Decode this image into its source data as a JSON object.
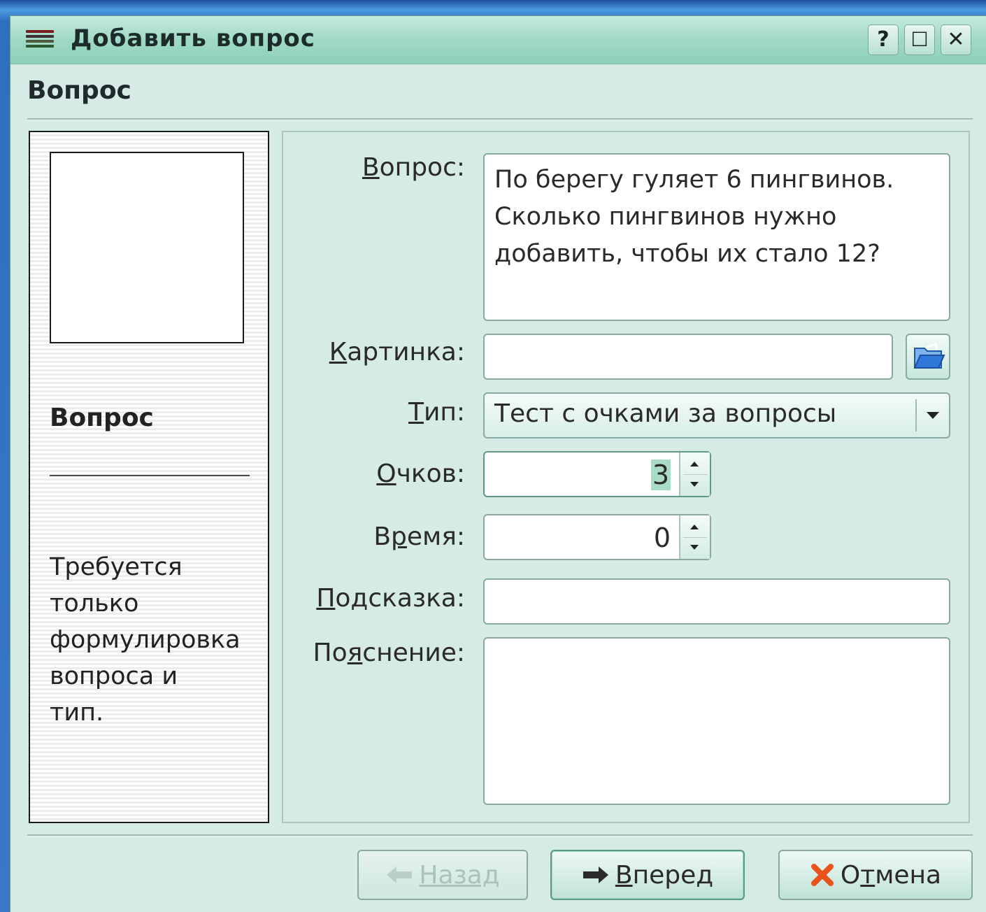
{
  "window": {
    "title": "Добавить вопрос",
    "help_button": "?",
    "maximize_button": "☐",
    "close_button": "✕"
  },
  "page": {
    "heading": "Вопрос"
  },
  "side": {
    "title": "Вопрос",
    "description": "Требуется\nтолько\nформулировка\nвопроса и\nтип."
  },
  "form": {
    "question_label": "Вопрос:",
    "question_value": "По берегу гуляет 6 пингвинов.\nСколько пингвинов нужно\nдобавить, чтобы их стало 12?",
    "picture_label": "Картинка:",
    "picture_value": "",
    "type_label": "Тип:",
    "type_value": "Тест с очками за вопросы",
    "points_label": "Очков:",
    "points_value": "3",
    "time_label": "Время:",
    "time_value": "0",
    "hint_label": "Подсказка:",
    "hint_value": "",
    "explanation_label": "Пояснение:",
    "explanation_value": ""
  },
  "buttons": {
    "back_label": "Назад",
    "next_label": "Вперед",
    "cancel_label": "Отмена"
  },
  "icons": {
    "menu": "menu-icon",
    "browse": "folder-open-icon",
    "back": "arrow-left-icon",
    "next": "arrow-right-icon",
    "cancel": "cancel-x-icon"
  },
  "colors": {
    "titlebar": "#9fd9c6",
    "window_bg": "#d6ebe6",
    "cancel_icon": "#e8541c",
    "folder_icon": "#2d78d8"
  }
}
